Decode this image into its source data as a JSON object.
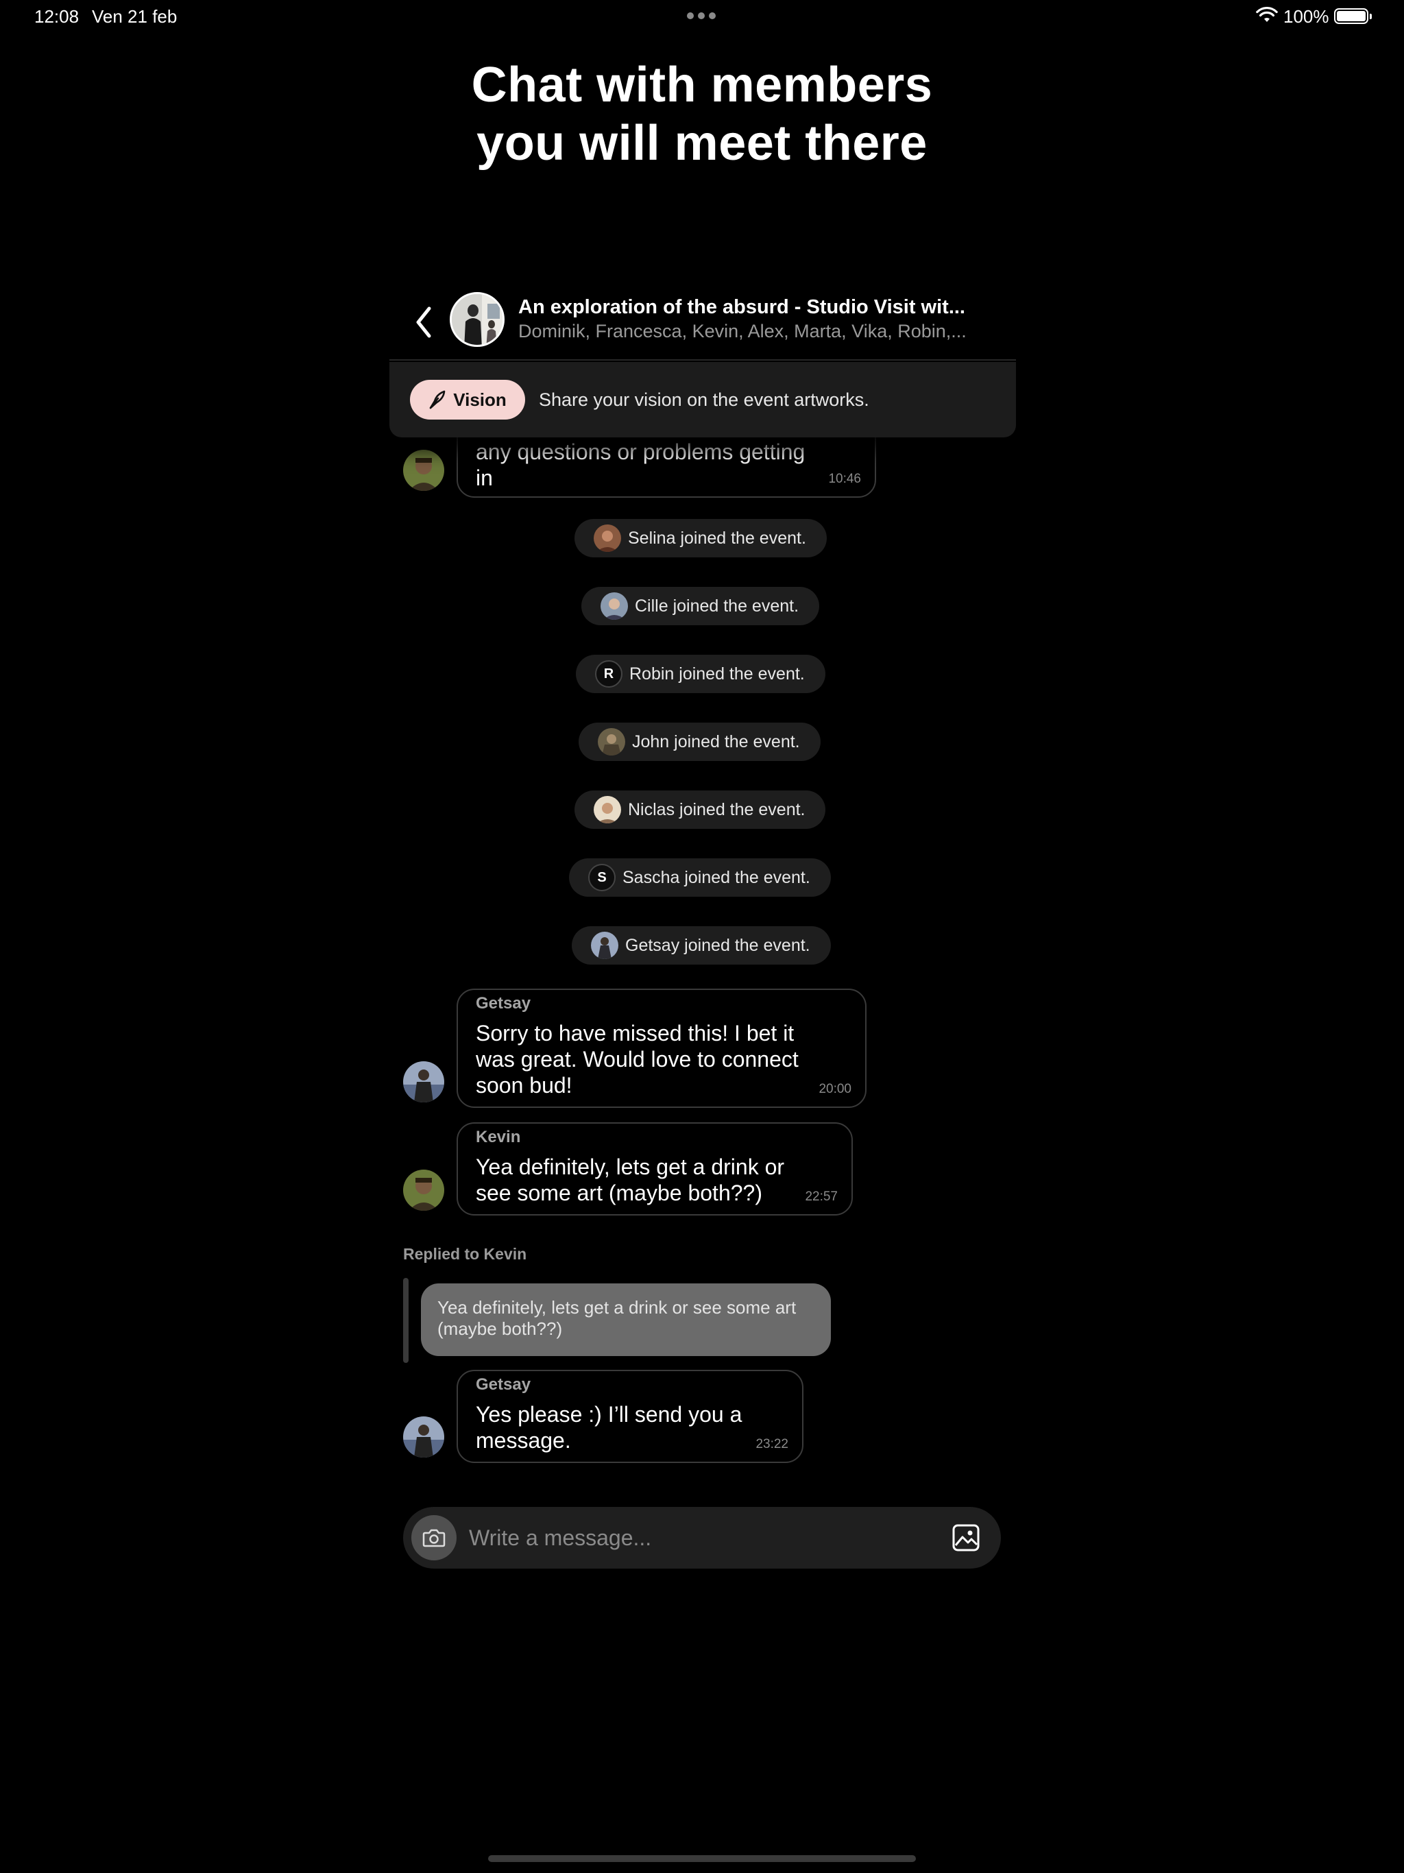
{
  "status_bar": {
    "time": "12:08",
    "date": "Ven 21 feb",
    "battery": "100%"
  },
  "headline": {
    "line1": "Chat with members",
    "line2": "you will meet there"
  },
  "chat_header": {
    "title": "An exploration of the absurd - Studio Visit wit...",
    "members": "Dominik, Francesca, Kevin, Alex, Marta, Vika, Robin,..."
  },
  "vision": {
    "button_label": "Vision",
    "text": "Share your vision on the event artworks."
  },
  "messages": {
    "top": {
      "line1": "any questions or problems getting",
      "line2": "in",
      "time": "10:46"
    },
    "getsay1": {
      "sender": "Getsay",
      "line1": "Sorry to have missed this! I bet it",
      "line2": "was great. Would love to connect",
      "line3": "soon bud!",
      "time": "20:00"
    },
    "kevin": {
      "sender": "Kevin",
      "line1": "Yea definitely, lets get a drink or",
      "line2": "see some art (maybe both??)",
      "time": "22:57"
    },
    "reply": {
      "label": "Replied to Kevin",
      "line1": "Yea definitely, lets get a drink or see some art",
      "line2": "(maybe both??)"
    },
    "getsay2": {
      "sender": "Getsay",
      "line1": "Yes please :) I’ll send you a",
      "line2": "message.",
      "time": "23:22"
    }
  },
  "joins": [
    {
      "text": "Selina joined the event.",
      "letter": ""
    },
    {
      "text": "Cille joined the event.",
      "letter": ""
    },
    {
      "text": "Robin joined the event.",
      "letter": "R"
    },
    {
      "text": "John joined the event.",
      "letter": ""
    },
    {
      "text": "Niclas joined the event.",
      "letter": ""
    },
    {
      "text": "Sascha joined the event.",
      "letter": "S"
    },
    {
      "text": "Getsay joined the event.",
      "letter": ""
    }
  ],
  "composer": {
    "placeholder": "Write a message..."
  },
  "icons": {
    "back": "chevron-left-icon",
    "vision": "feather-icon",
    "camera": "camera-icon",
    "gallery": "image-icon",
    "wifi": "wifi-icon",
    "battery": "battery-icon"
  }
}
